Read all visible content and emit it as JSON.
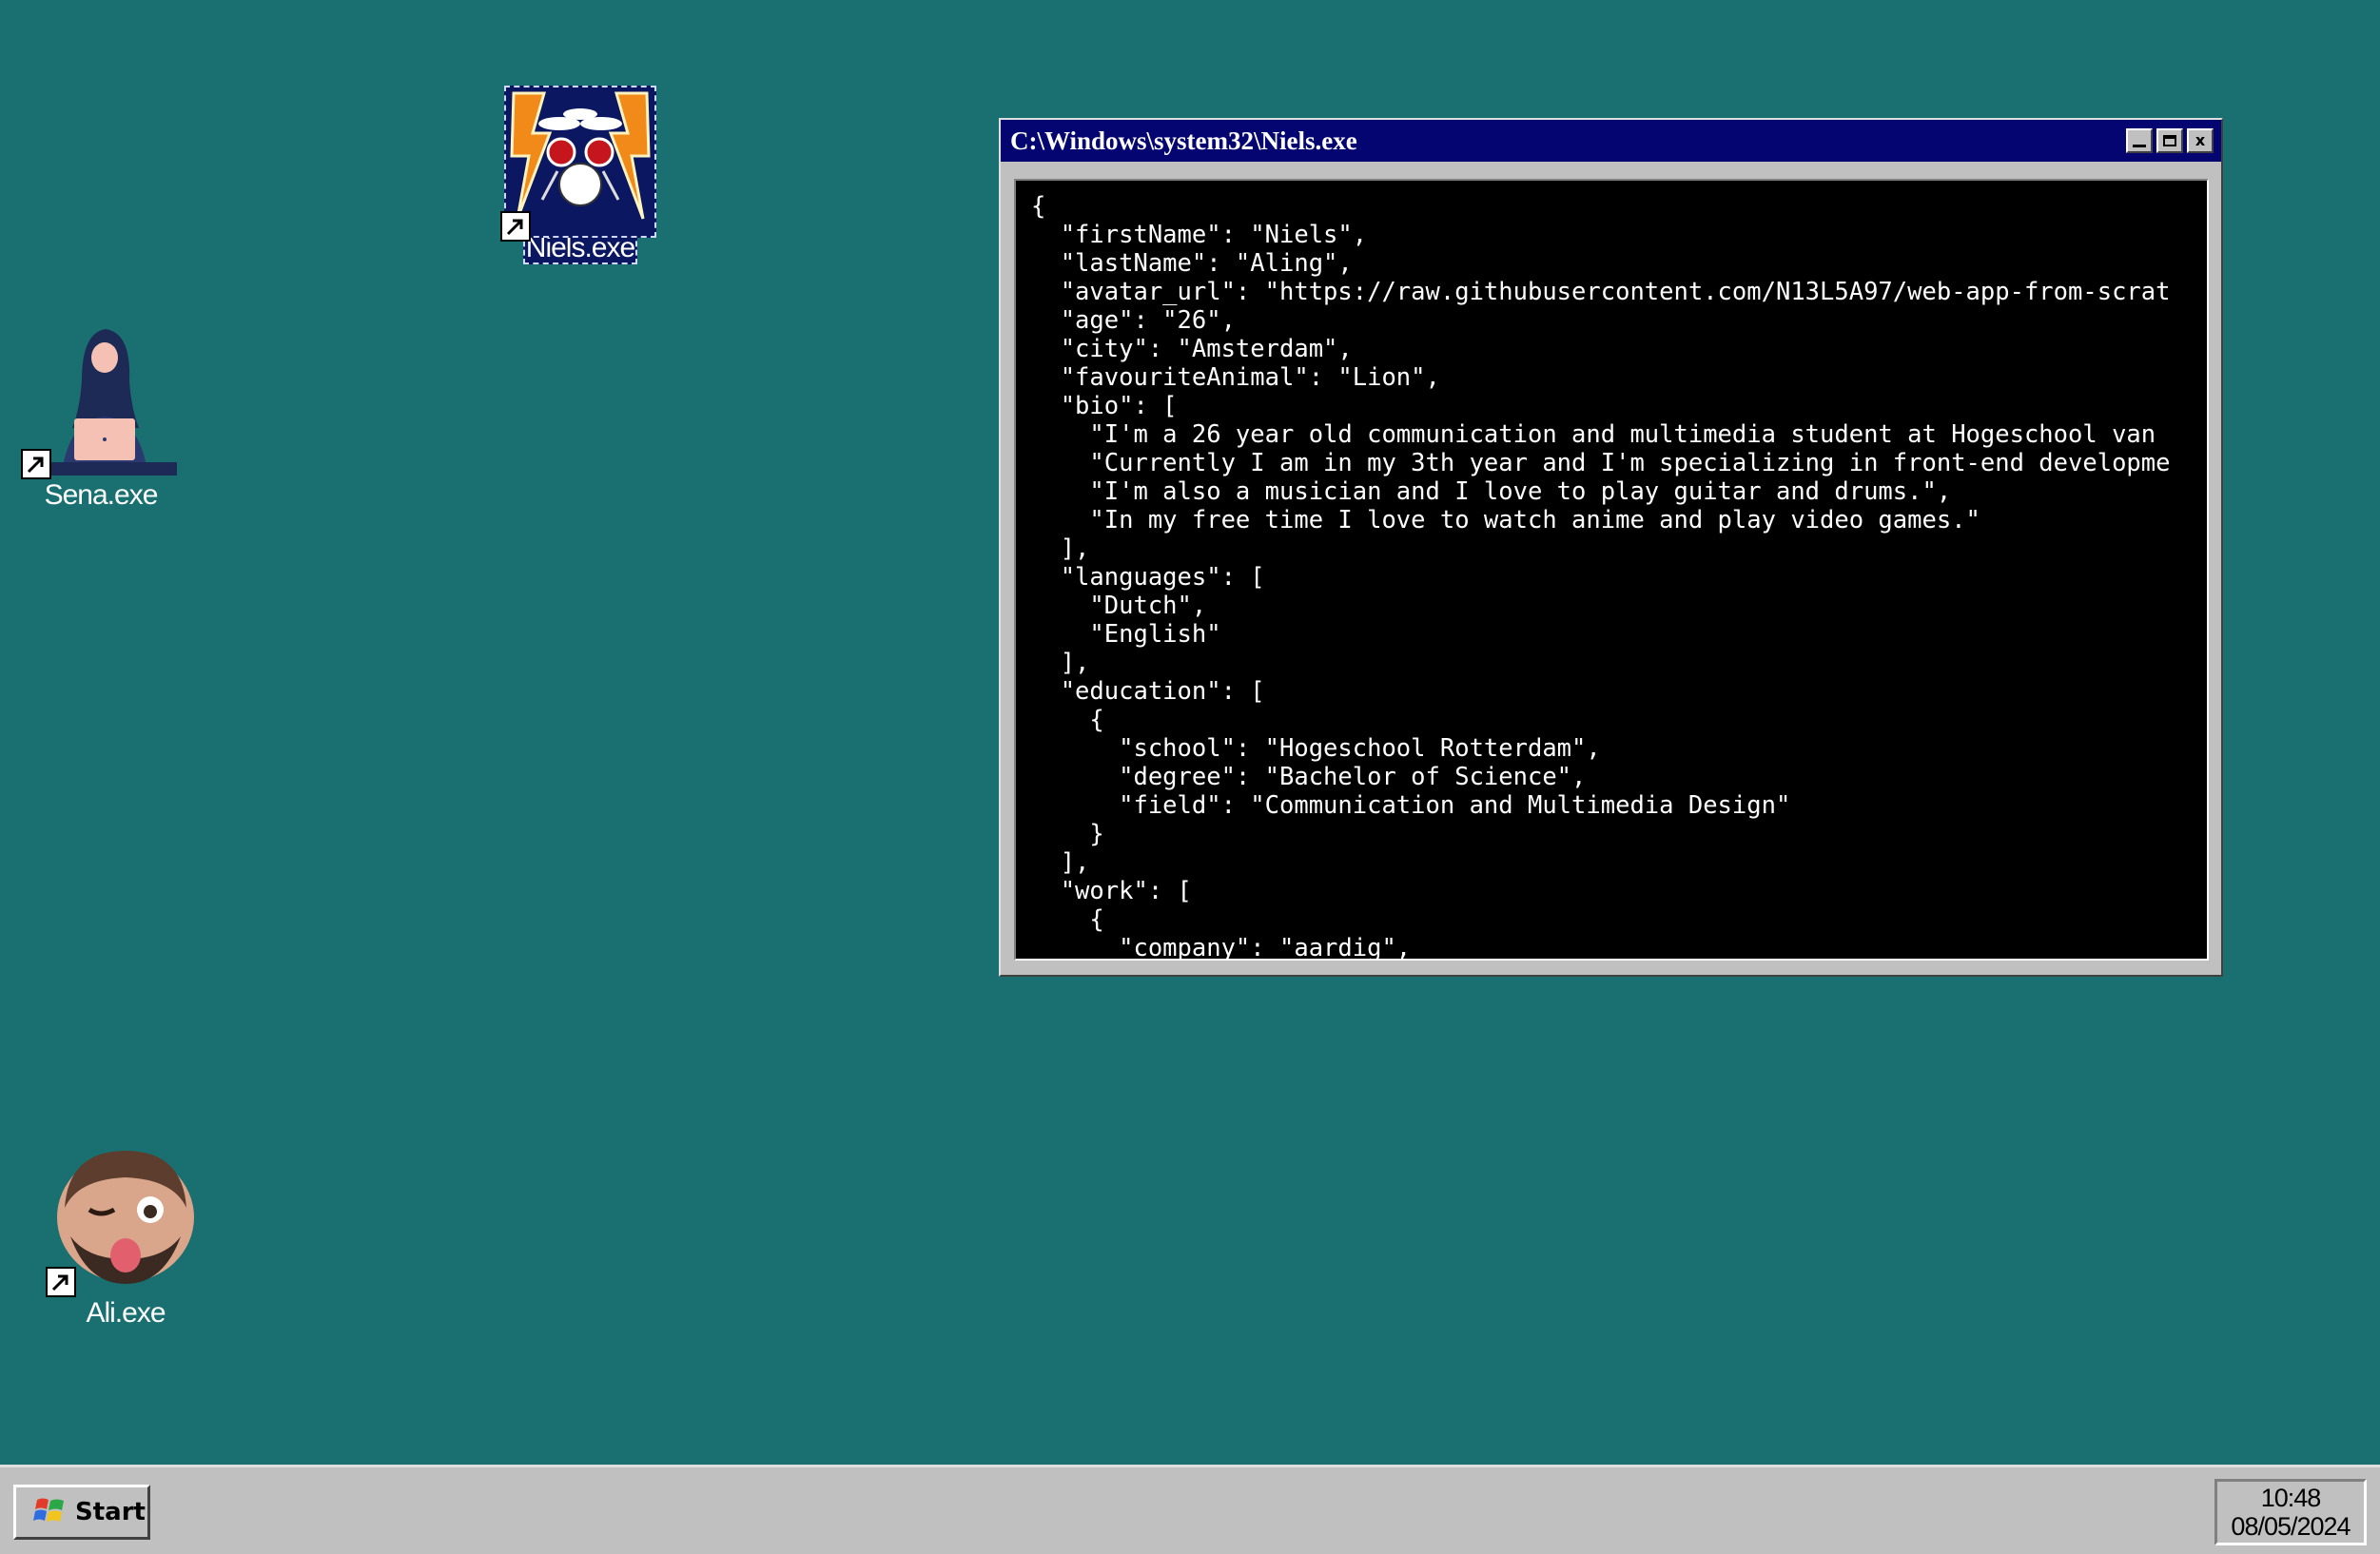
{
  "desktop": {
    "icons": [
      {
        "label": "Niels.exe",
        "icon": "drum-kit-icon"
      },
      {
        "label": "Sena.exe",
        "icon": "person-laptop-icon"
      },
      {
        "label": "Ali.exe",
        "icon": "winking-face-icon"
      }
    ],
    "background_color": "#1a7070"
  },
  "window": {
    "title": "C:\\Windows\\system32\\Niels.exe",
    "titlebar_color": "#050571",
    "buttons": {
      "minimize": "minimize",
      "maximize": "maximize",
      "close": "x"
    },
    "console_text": "{\n  \"firstName\": \"Niels\",\n  \"lastName\": \"Aling\",\n  \"avatar_url\": \"https://raw.githubusercontent.com/N13L5A97/web-app-from-scrat\n  \"age\": \"26\",\n  \"city\": \"Amsterdam\",\n  \"favouriteAnimal\": \"Lion\",\n  \"bio\": [\n    \"I'm a 26 year old communication and multimedia student at Hogeschool van \n    \"Currently I am in my 3th year and I'm specializing in front-end developme\n    \"I'm also a musician and I love to play guitar and drums.\",\n    \"In my free time I love to watch anime and play video games.\"\n  ],\n  \"languages\": [\n    \"Dutch\",\n    \"English\"\n  ],\n  \"education\": [\n    {\n      \"school\": \"Hogeschool Rotterdam\",\n      \"degree\": \"Bachelor of Science\",\n      \"field\": \"Communication and Multimedia Design\"\n    }\n  ],\n  \"work\": [\n    {\n      \"company\": \"aardig\","
  },
  "taskbar": {
    "start_label": "Start",
    "clock_time": "10:48",
    "clock_date": "08/05/2024"
  }
}
